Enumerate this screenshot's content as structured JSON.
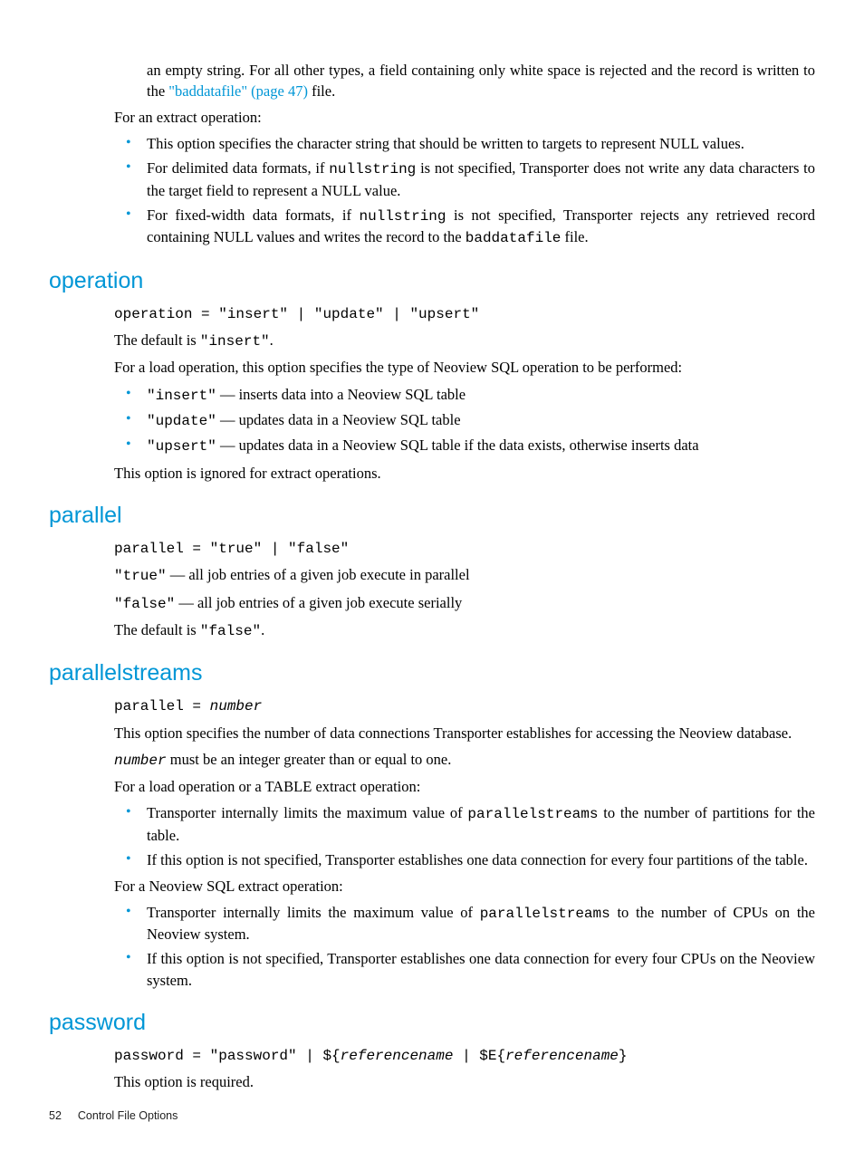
{
  "intro_top": {
    "p1_a": "an empty string. For all other types, a field containing only white space is rejected and the record is written to the ",
    "p1_link": "\"baddatafile\" (page 47)",
    "p1_b": " file.",
    "p2": "For an extract operation:",
    "b1": "This option specifies the character string that should be written to targets to represent NULL values.",
    "b2_a": "For delimited data formats, if ",
    "b2_code": "nullstring",
    "b2_b": " is not specified, Transporter does not write any data characters to the target field to represent a NULL value.",
    "b3_a": "For fixed-width data formats, if ",
    "b3_code1": "nullstring",
    "b3_b": " is not specified, Transporter rejects any retrieved record containing NULL values and writes the record to the ",
    "b3_code2": "baddatafile",
    "b3_c": " file."
  },
  "operation": {
    "heading": "operation",
    "syntax": "operation = \"insert\" | \"update\" | \"upsert\"",
    "p1_a": "The default is ",
    "p1_code": "\"insert\"",
    "p1_b": ".",
    "p2": "For a load operation, this option specifies the type of Neoview SQL operation to be performed:",
    "b1_code": "\"insert\"",
    "b1_txt": " — inserts data into a Neoview SQL table",
    "b2_code": "\"update\"",
    "b2_txt": " — updates data in a Neoview SQL table",
    "b3_code": "\"upsert\"",
    "b3_txt": " — updates data in a Neoview SQL table if the data exists, otherwise inserts data",
    "p3": "This option is ignored for extract operations."
  },
  "parallel": {
    "heading": "parallel",
    "syntax": "parallel = \"true\" | \"false\"",
    "l1_code": "\"true\"",
    "l1_txt": " — all job entries of a given job execute in parallel",
    "l2_code": "\"false\"",
    "l2_txt": " — all job entries of a given job execute serially",
    "p_a": "The default is ",
    "p_code": "\"false\"",
    "p_b": "."
  },
  "parallelstreams": {
    "heading": "parallelstreams",
    "syntax_a": "parallel = ",
    "syntax_i": "number",
    "p1": "This option specifies the number of data connections Transporter establishes for accessing the Neoview database.",
    "p2_i": "number",
    "p2_txt": " must be an integer greater than or equal to one.",
    "p3": "For a load operation or a TABLE extract operation:",
    "b1_a": "Transporter internally limits the maximum value of ",
    "b1_code": "parallelstreams",
    "b1_b": " to the number of partitions for the table.",
    "b2": "If this option is not specified, Transporter establishes one data connection for every four partitions of the table.",
    "p4": "For a Neoview SQL extract operation:",
    "b3_a": "Transporter internally limits the maximum value of ",
    "b3_code": "parallelstreams",
    "b3_b": " to the number of CPUs on the Neoview system.",
    "b4": "If this option is not specified, Transporter establishes one data connection for every four CPUs on the Neoview system."
  },
  "password": {
    "heading": "password",
    "syntax_a": "password = \"password\" | ${",
    "syntax_i1": "referencename",
    "syntax_b": " | $E{",
    "syntax_i2": "referencename",
    "syntax_c": "}",
    "p1": "This option is required."
  },
  "footer": {
    "page": "52",
    "title": "Control File Options"
  }
}
